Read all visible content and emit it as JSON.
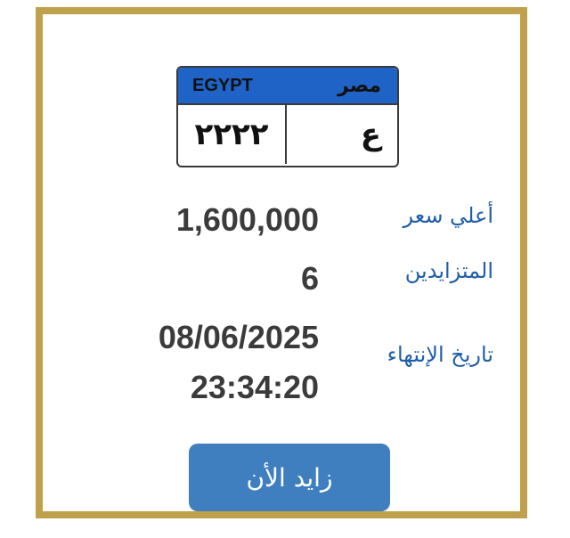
{
  "plate": {
    "country_en": "EGYPT",
    "country_ar": "مصر",
    "numbers": "٢٢٢٢",
    "letters": "ع"
  },
  "details": {
    "highest_price_label": "أعلي سعر",
    "highest_price_value": "1,600,000",
    "bidders_label": "المتزايدين",
    "bidders_value": "6",
    "end_date_label": "تاريخ الإنتهاء",
    "end_date_value": "08/06/2025",
    "end_time_value": "23:34:20"
  },
  "actions": {
    "bid_now_label": "زايد الأن"
  },
  "colors": {
    "frame": "#c0a14b",
    "plate_header": "#1f63c6",
    "label": "#1f5ea8",
    "value": "#3b3b3b",
    "button": "#3f7fc0"
  }
}
